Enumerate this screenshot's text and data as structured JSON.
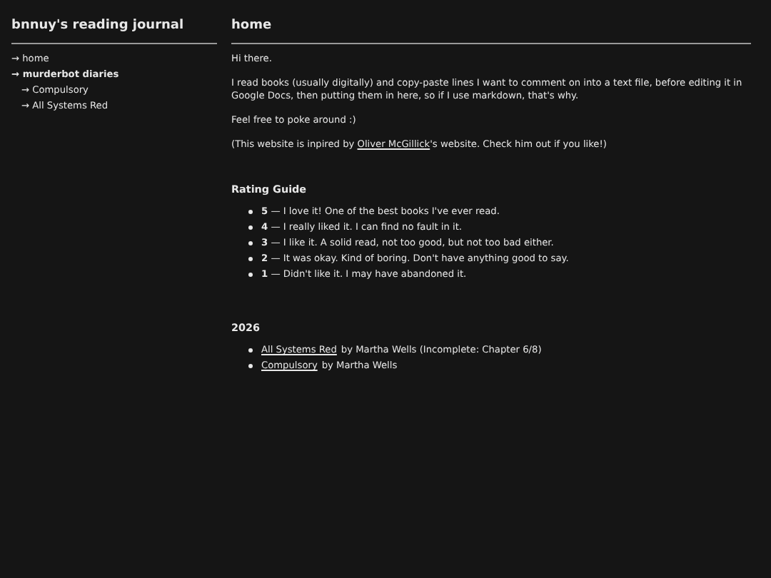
{
  "site_title": "bnnuy's reading journal",
  "sidebar": {
    "items": [
      {
        "arrow": "→",
        "label": "home"
      },
      {
        "arrow": "→",
        "label": "murderbot diaries",
        "children": [
          {
            "arrow": "→",
            "label": "Compulsory"
          },
          {
            "arrow": "→",
            "label": "All Systems Red"
          }
        ]
      }
    ]
  },
  "page_title": "home",
  "paragraphs": [
    {
      "text": "Hi there."
    },
    {
      "text": "I read books (usually digitally) and copy-paste lines I want to comment on into a text file, before editing it in Google Docs, then putting them in here, so if I use markdown, that's why."
    },
    {
      "text": "Feel free to poke around :)"
    },
    {
      "before": "(This website is inpired by ",
      "link": "Oliver McGillick",
      "after": "'s website. Check him out if you like!)"
    }
  ],
  "rating_guide": {
    "heading": "Rating Guide",
    "items": [
      {
        "score": "5",
        "text": "— I love it! One of the best books I've ever read."
      },
      {
        "score": "4",
        "text": "— I really liked it. I can find no fault in it."
      },
      {
        "score": "3",
        "text": "— I like it. A solid read, not too good, but not too bad either."
      },
      {
        "score": "2",
        "text": "— It was okay. Kind of boring. Don't have anything good to say."
      },
      {
        "score": "1",
        "text": "— Didn't like it. I may have abandoned it."
      }
    ]
  },
  "year_section": {
    "heading": "2026",
    "books": [
      {
        "title": "All Systems Red",
        "text": "by Martha Wells (Incomplete: Chapter 6/8)"
      },
      {
        "title": "Compulsory",
        "text": "by Martha Wells"
      }
    ]
  }
}
